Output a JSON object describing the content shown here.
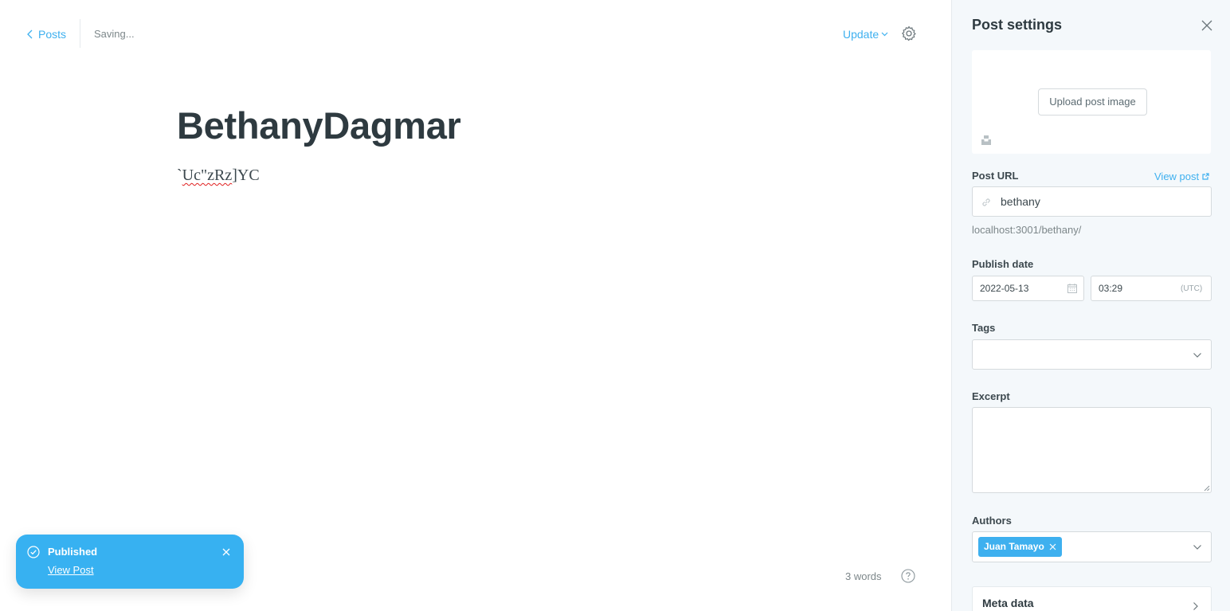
{
  "header": {
    "back_label": "Posts",
    "status": "Saving...",
    "update_label": "Update"
  },
  "post": {
    "title": "BethanyDagmar",
    "body_prefix": "`",
    "body_misspelled": "Uc\"zRz",
    "body_suffix": "]YC",
    "word_count": "3 words"
  },
  "toast": {
    "title": "Published",
    "link": "View Post"
  },
  "settings": {
    "title": "Post settings",
    "upload_label": "Upload post image",
    "post_url_label": "Post URL",
    "view_post_label": "View post",
    "slug": "bethany",
    "url_hint": "localhost:3001/bethany/",
    "publish_date_label": "Publish date",
    "date": "2022-05-13",
    "time": "03:29",
    "timezone": "(UTC)",
    "tags_label": "Tags",
    "excerpt_label": "Excerpt",
    "authors_label": "Authors",
    "author_token": "Juan Tamayo",
    "meta_label": "Meta data"
  },
  "colors": {
    "accent": "#3eb0ef",
    "toast": "#37b1f1",
    "panel_bg": "#f4f8fb"
  },
  "icons": [
    "chevron-left-icon",
    "chevron-down-icon",
    "gear-icon",
    "help-icon",
    "check-circle-icon",
    "close-icon",
    "unsplash-icon",
    "external-link-icon",
    "link-icon",
    "calendar-icon",
    "chevron-right-icon"
  ]
}
